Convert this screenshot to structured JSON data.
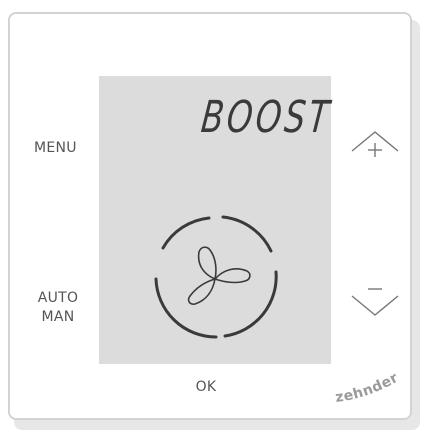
{
  "buttons": {
    "menu": "MENU",
    "auto": "AUTO",
    "man": "MAN",
    "ok": "OK",
    "up_icon": "plus-chevron-up",
    "down_icon": "minus-chevron-down"
  },
  "display": {
    "mode_text": "BOOST",
    "fan_icon": "fan-icon"
  },
  "brand": {
    "logo_text": "zehnder"
  },
  "colors": {
    "lcd_background": "#dcdcdc",
    "segment": "#3a3a3a",
    "panel_border": "#d3d3d3",
    "label": "#555555"
  }
}
